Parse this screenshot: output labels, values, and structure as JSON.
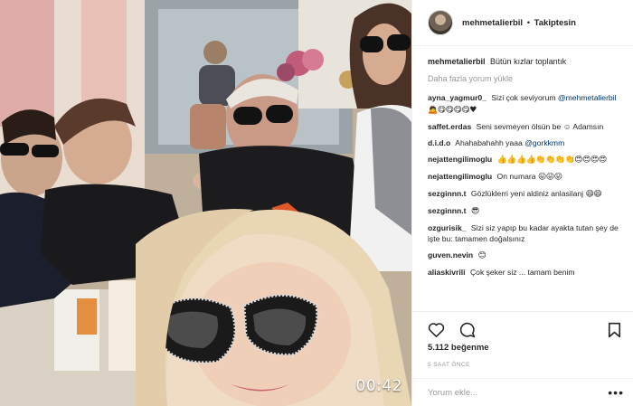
{
  "header": {
    "username": "mehmetalierbil",
    "separator": "•",
    "follow_status": "Takiptesin"
  },
  "caption": {
    "username": "mehmetalierbil",
    "text": "Bütün kızlar toplantık"
  },
  "load_more_label": "Daha fazla yorum yükle",
  "comments": [
    {
      "user": "ayna_yagmur0_",
      "text": "Sizi çok seviyorum",
      "mention": "@mehmetalierbil",
      "emoji": "🙇😋😋😋😋♥"
    },
    {
      "user": "saffet.erdas",
      "text": "Seni sevmeyen ölsün be ☺ Adamsın",
      "mention": "",
      "emoji": ""
    },
    {
      "user": "d.i.d.o",
      "text": "Ahahabahahh yaaa",
      "mention": "@gorkkmm",
      "emoji": ""
    },
    {
      "user": "nejattengilimoglu",
      "text": "",
      "mention": "",
      "emoji": "👍👍👍👍👏👏👏👏😍😍😍😍"
    },
    {
      "user": "nejattengilimoglu",
      "text": "On numara",
      "mention": "",
      "emoji": "😛😛😛"
    },
    {
      "user": "sezginnn.t",
      "text": "Gözlüklerri yeni aldiniz anlasilanj",
      "mention": "",
      "emoji": "😄😄"
    },
    {
      "user": "sezginnn.t",
      "text": "",
      "mention": "",
      "emoji": "😎"
    },
    {
      "user": "ozgurisik_",
      "text": "Sizi siz yapıp bu kadar ayakta tutan şey de işte bu: tamamen doğalsınız",
      "mention": "",
      "emoji": ""
    },
    {
      "user": "guven.nevin",
      "text": "",
      "mention": "",
      "emoji": "😊"
    },
    {
      "user": "aliaskivrili",
      "text": "Çok şeker siz ... tamam benim",
      "mention": "",
      "emoji": ""
    }
  ],
  "likes": "5.112 beğenme",
  "timestamp": "5 SAAT ÖNCE",
  "add_comment": {
    "placeholder": "Yorum ekle..."
  },
  "more_options": "•••",
  "video_time": "00:42",
  "icons": {
    "like": "heart-icon",
    "comment": "comment-bubble-icon",
    "bookmark": "bookmark-icon",
    "avatar": "profile-avatar"
  },
  "colors": {
    "text": "#262626",
    "secondary": "#999999",
    "link": "#003569",
    "border": "#efefef"
  }
}
